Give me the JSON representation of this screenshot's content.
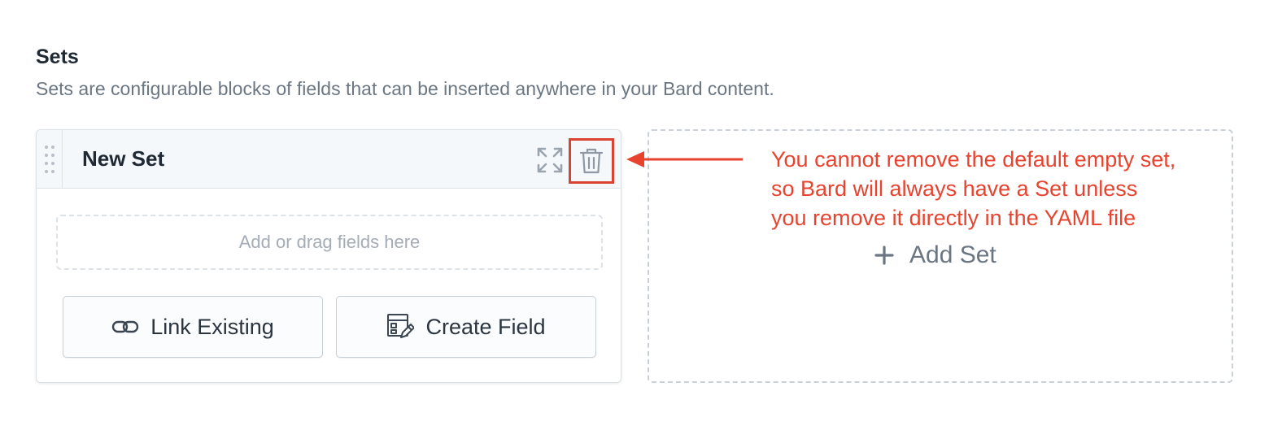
{
  "section": {
    "title": "Sets",
    "description": "Sets are configurable blocks of fields that can be inserted anywhere in your Bard content."
  },
  "set_card": {
    "name": "New Set",
    "icons": {
      "drag": "drag-handle-icon",
      "expand": "expand-icon",
      "delete": "trash-icon"
    },
    "drop_zone_text": "Add or drag fields here",
    "link_existing_label": "Link Existing",
    "create_field_label": "Create Field"
  },
  "add_set_label": "Add Set",
  "annotation": {
    "lines": [
      "You cannot remove the default empty set,",
      "so Bard will always have a Set unless",
      "you remove it directly in the YAML file"
    ]
  },
  "colors": {
    "annotation_red": "#e8432f",
    "highlight_border": "#d9432f",
    "header_bg": "#f5f8fb",
    "muted_text": "#6b7683"
  }
}
